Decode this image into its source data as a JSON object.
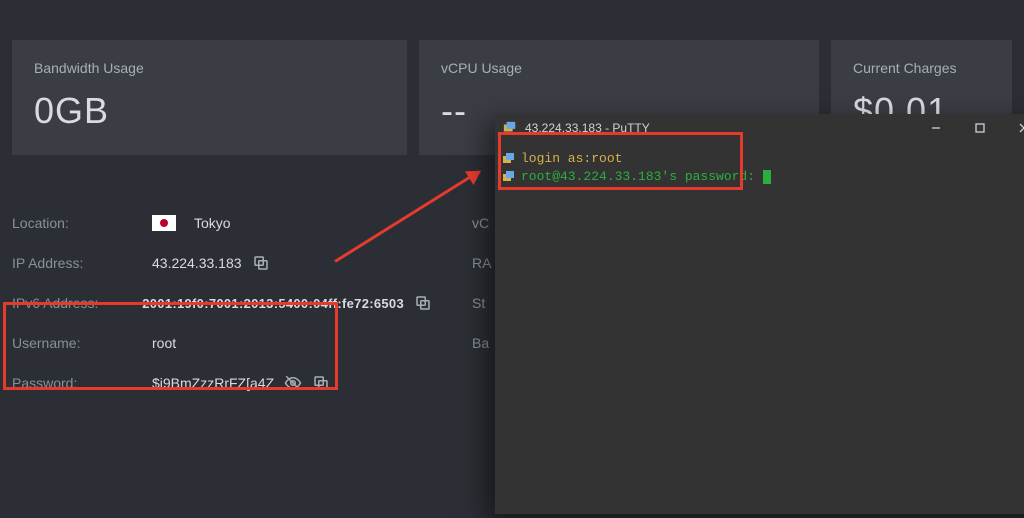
{
  "cards": {
    "bandwidth": {
      "title": "Bandwidth Usage",
      "value": "0GB"
    },
    "vcpu": {
      "title": "vCPU Usage",
      "value": "--"
    },
    "charges": {
      "title": "Current Charges",
      "value": "$0.01"
    }
  },
  "details": {
    "location": {
      "label": "Location:",
      "value": "Tokyo"
    },
    "ip": {
      "label": "IP Address:",
      "value": "43.224.33.183"
    },
    "ipv6": {
      "label": "IPv6 Address:",
      "value": "2001:19f0:7001:2013:5400:04ff:fe72:6503"
    },
    "username": {
      "label": "Username:",
      "value": "root"
    },
    "password": {
      "label": "Password:",
      "value": "$i9BmZzzRrFZ[a4Z"
    }
  },
  "details2": {
    "vc": "vC",
    "ra": "RA",
    "st": "St",
    "ba": "Ba"
  },
  "putty": {
    "title": "43.224.33.183 - PuTTY",
    "line1_pre": "login as:",
    "line1_val": "root",
    "line2": "root@43.224.33.183's password:"
  }
}
